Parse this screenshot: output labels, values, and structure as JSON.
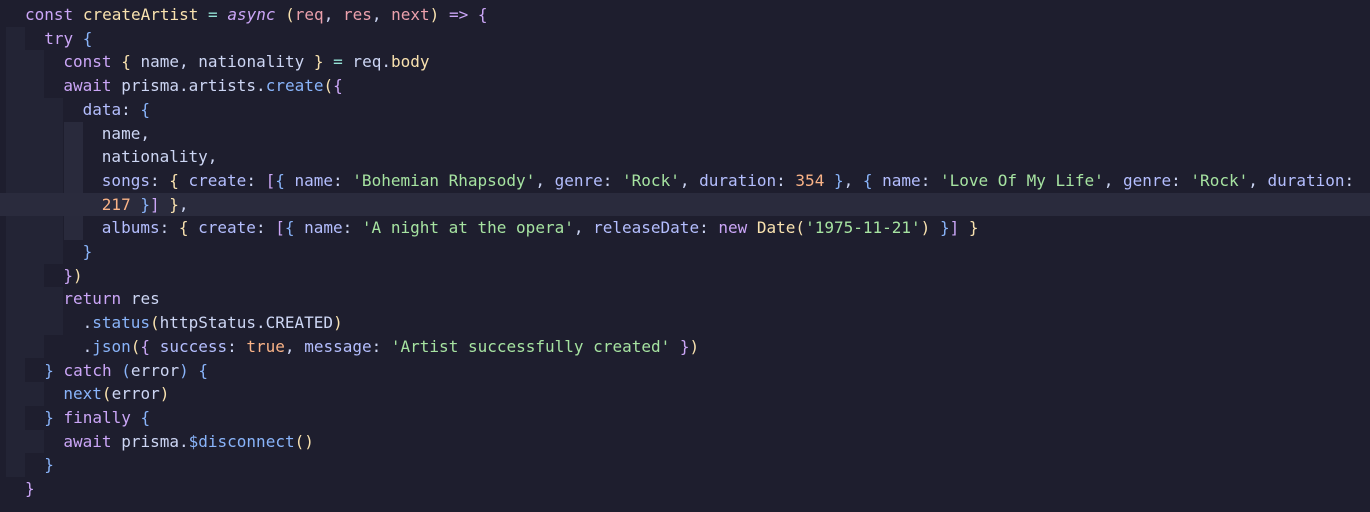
{
  "editor": {
    "colors": {
      "background": "#1e1e2e",
      "current_line": "#2a2b3d",
      "keyword": "#cba6f7",
      "string": "#a6e3a1",
      "number": "#fab387",
      "function": "#89b4fa",
      "bracket_1": "#f9e2af",
      "bracket_2": "#cba6f7",
      "bracket_3": "#89b4fa"
    },
    "lines": [
      [
        {
          "t": "const",
          "c": "c-kw"
        },
        {
          "t": " "
        },
        {
          "t": "createArtist",
          "c": "c-decl"
        },
        {
          "t": " "
        },
        {
          "t": "=",
          "c": "c-op"
        },
        {
          "t": " "
        },
        {
          "t": "async",
          "c": "c-async"
        },
        {
          "t": " "
        },
        {
          "t": "(",
          "c": "c-b1"
        },
        {
          "t": "req",
          "c": "c-param"
        },
        {
          "t": ", "
        },
        {
          "t": "res",
          "c": "c-param"
        },
        {
          "t": ", "
        },
        {
          "t": "next",
          "c": "c-param"
        },
        {
          "t": ")",
          "c": "c-b1"
        },
        {
          "t": " "
        },
        {
          "t": "=>",
          "c": "c-kw"
        },
        {
          "t": " "
        },
        {
          "t": "{",
          "c": "c-b2"
        }
      ],
      [
        {
          "t": "try",
          "c": "c-kw"
        },
        {
          "t": " "
        },
        {
          "t": "{",
          "c": "c-b3"
        }
      ],
      [
        {
          "t": "const",
          "c": "c-kw"
        },
        {
          "t": " "
        },
        {
          "t": "{",
          "c": "c-b1"
        },
        {
          "t": " name, nationality "
        },
        {
          "t": "}",
          "c": "c-b1"
        },
        {
          "t": " "
        },
        {
          "t": "=",
          "c": "c-op"
        },
        {
          "t": " req."
        },
        {
          "t": "body",
          "c": "c-decl"
        }
      ],
      [
        {
          "t": "await",
          "c": "c-kw"
        },
        {
          "t": " prisma.artists."
        },
        {
          "t": "create",
          "c": "c-fn"
        },
        {
          "t": "(",
          "c": "c-b1"
        },
        {
          "t": "{",
          "c": "c-b2"
        }
      ],
      [
        {
          "t": "data",
          "c": "c-prop"
        },
        {
          "t": ": "
        },
        {
          "t": "{",
          "c": "c-b3"
        }
      ],
      [
        {
          "t": "name,"
        }
      ],
      [
        {
          "t": "nationality,"
        }
      ],
      [
        {
          "t": "songs",
          "c": "c-prop"
        },
        {
          "t": ": "
        },
        {
          "t": "{",
          "c": "c-b1"
        },
        {
          "t": " "
        },
        {
          "t": "create",
          "c": "c-prop"
        },
        {
          "t": ": "
        },
        {
          "t": "[",
          "c": "c-b2"
        },
        {
          "t": "{",
          "c": "c-b3"
        },
        {
          "t": " "
        },
        {
          "t": "name",
          "c": "c-prop"
        },
        {
          "t": ": "
        },
        {
          "t": "'Bohemian Rhapsody'",
          "c": "c-str"
        },
        {
          "t": ", "
        },
        {
          "t": "genre",
          "c": "c-prop"
        },
        {
          "t": ": "
        },
        {
          "t": "'Rock'",
          "c": "c-str"
        },
        {
          "t": ", "
        },
        {
          "t": "duration",
          "c": "c-prop"
        },
        {
          "t": ": "
        },
        {
          "t": "354",
          "c": "c-num"
        },
        {
          "t": " "
        },
        {
          "t": "}",
          "c": "c-b3"
        },
        {
          "t": ", "
        },
        {
          "t": "{",
          "c": "c-b3"
        },
        {
          "t": " "
        },
        {
          "t": "name",
          "c": "c-prop"
        },
        {
          "t": ": "
        },
        {
          "t": "'Love Of My Life'",
          "c": "c-str"
        },
        {
          "t": ", "
        },
        {
          "t": "genre",
          "c": "c-prop"
        },
        {
          "t": ": "
        },
        {
          "t": "'Rock'",
          "c": "c-str"
        },
        {
          "t": ", "
        },
        {
          "t": "duration",
          "c": "c-prop"
        },
        {
          "t": ":"
        }
      ],
      [
        {
          "t": "217",
          "c": "c-num"
        },
        {
          "t": " "
        },
        {
          "t": "}",
          "c": "c-b3"
        },
        {
          "t": "]",
          "c": "c-b2"
        },
        {
          "t": " "
        },
        {
          "t": "}",
          "c": "c-b1"
        },
        {
          "t": ","
        }
      ],
      [
        {
          "t": "albums",
          "c": "c-prop"
        },
        {
          "t": ": "
        },
        {
          "t": "{",
          "c": "c-b1"
        },
        {
          "t": " "
        },
        {
          "t": "create",
          "c": "c-prop"
        },
        {
          "t": ": "
        },
        {
          "t": "[",
          "c": "c-b2"
        },
        {
          "t": "{",
          "c": "c-b3"
        },
        {
          "t": " "
        },
        {
          "t": "name",
          "c": "c-prop"
        },
        {
          "t": ": "
        },
        {
          "t": "'A night at the opera'",
          "c": "c-str"
        },
        {
          "t": ", "
        },
        {
          "t": "releaseDate",
          "c": "c-prop"
        },
        {
          "t": ": "
        },
        {
          "t": "new",
          "c": "c-kw"
        },
        {
          "t": " "
        },
        {
          "t": "Date",
          "c": "c-class"
        },
        {
          "t": "(",
          "c": "c-b1"
        },
        {
          "t": "'1975-11-21'",
          "c": "c-str"
        },
        {
          "t": ")",
          "c": "c-b1"
        },
        {
          "t": " "
        },
        {
          "t": "}",
          "c": "c-b3"
        },
        {
          "t": "]",
          "c": "c-b2"
        },
        {
          "t": " "
        },
        {
          "t": "}",
          "c": "c-b1"
        }
      ],
      [
        {
          "t": "}",
          "c": "c-b3"
        }
      ],
      [
        {
          "t": "}",
          "c": "c-b2"
        },
        {
          "t": ")",
          "c": "c-b1"
        }
      ],
      [
        {
          "t": "return",
          "c": "c-kw"
        },
        {
          "t": " res"
        }
      ],
      [
        {
          "t": "."
        },
        {
          "t": "status",
          "c": "c-fn"
        },
        {
          "t": "(",
          "c": "c-b1"
        },
        {
          "t": "httpStatus.CREATED"
        },
        {
          "t": ")",
          "c": "c-b1"
        }
      ],
      [
        {
          "t": "."
        },
        {
          "t": "json",
          "c": "c-fn"
        },
        {
          "t": "(",
          "c": "c-b1"
        },
        {
          "t": "{",
          "c": "c-b2"
        },
        {
          "t": " "
        },
        {
          "t": "success",
          "c": "c-prop"
        },
        {
          "t": ": "
        },
        {
          "t": "true",
          "c": "c-bool"
        },
        {
          "t": ", "
        },
        {
          "t": "message",
          "c": "c-prop"
        },
        {
          "t": ": "
        },
        {
          "t": "'Artist successfully created'",
          "c": "c-str"
        },
        {
          "t": " "
        },
        {
          "t": "}",
          "c": "c-b2"
        },
        {
          "t": ")",
          "c": "c-b1"
        }
      ],
      [
        {
          "t": "}",
          "c": "c-b3"
        },
        {
          "t": " "
        },
        {
          "t": "catch",
          "c": "c-kw"
        },
        {
          "t": " "
        },
        {
          "t": "(",
          "c": "c-b3"
        },
        {
          "t": "error"
        },
        {
          "t": ")",
          "c": "c-b3"
        },
        {
          "t": " "
        },
        {
          "t": "{",
          "c": "c-b3"
        }
      ],
      [
        {
          "t": "next",
          "c": "c-fn"
        },
        {
          "t": "(",
          "c": "c-b1"
        },
        {
          "t": "error"
        },
        {
          "t": ")",
          "c": "c-b1"
        }
      ],
      [
        {
          "t": "}",
          "c": "c-b3"
        },
        {
          "t": " "
        },
        {
          "t": "finally",
          "c": "c-kw"
        },
        {
          "t": " "
        },
        {
          "t": "{",
          "c": "c-b3"
        }
      ],
      [
        {
          "t": "await",
          "c": "c-kw"
        },
        {
          "t": " prisma."
        },
        {
          "t": "$disconnect",
          "c": "c-fn"
        },
        {
          "t": "(",
          "c": "c-b1"
        },
        {
          "t": ")",
          "c": "c-b1"
        }
      ],
      [
        {
          "t": "}",
          "c": "c-b3"
        }
      ],
      [
        {
          "t": "}",
          "c": "c-b2"
        }
      ]
    ]
  }
}
